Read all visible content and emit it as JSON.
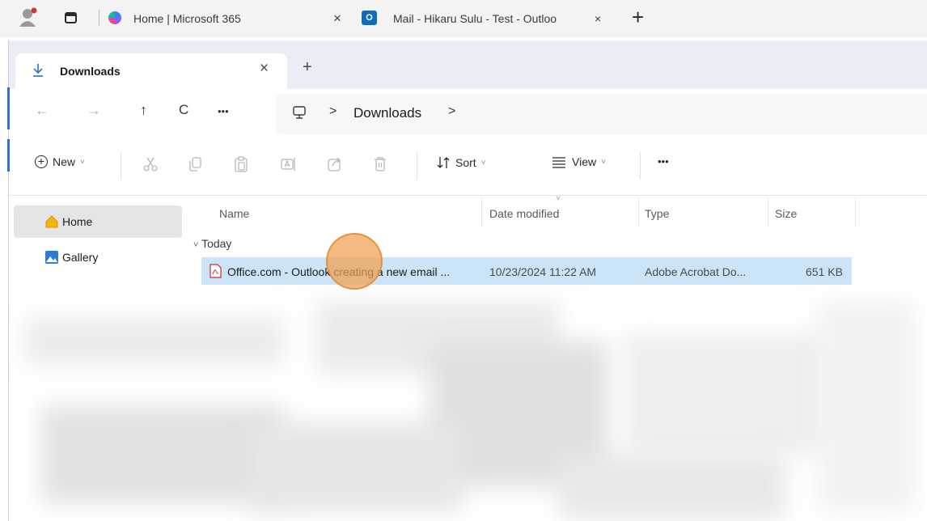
{
  "browser": {
    "tabs": [
      {
        "title": "Home | Microsoft 365",
        "close": "×"
      },
      {
        "title": "Mail - Hikaru Sulu - Test - Outloo",
        "close": "×"
      }
    ],
    "new_tab": "+"
  },
  "explorer": {
    "tab": {
      "title": "Downloads",
      "close": "×"
    },
    "new_tab": "+",
    "nav": {
      "back": "←",
      "forward": "→",
      "up": "↑",
      "refresh": "C",
      "more": "•••"
    },
    "breadcrumb": {
      "sep1": ">",
      "location": "Downloads",
      "sep2": ">"
    },
    "commands": {
      "new_label": "New",
      "new_chevron": "˅",
      "sort_label": "Sort",
      "sort_chevron": "˅",
      "view_label": "View",
      "view_chevron": "˅",
      "more": "•••"
    },
    "sidebar": {
      "items": [
        {
          "label": "Home",
          "selected": true
        },
        {
          "label": "Gallery",
          "selected": false
        }
      ]
    },
    "columns": [
      "Name",
      "Date modified",
      "Type",
      "Size"
    ],
    "group": {
      "label": "Today",
      "chevron": "˅"
    },
    "files": [
      {
        "name": "Office.com - Outlook creating a new email ...",
        "date_modified": "10/23/2024 11:22 AM",
        "type": "Adobe Acrobat Do...",
        "size": "651 KB"
      }
    ]
  },
  "colors": {
    "accent": "#0f6cbd",
    "selection": "#cce4f7",
    "click_indicator": "#f0a050"
  },
  "icons": [
    "avatar-icon",
    "tab-actions-icon",
    "microsoft365-icon",
    "outlook-icon",
    "download-icon",
    "computer-icon",
    "cut-icon",
    "copy-icon",
    "paste-icon",
    "rename-icon",
    "share-icon",
    "delete-icon",
    "sort-icon",
    "view-icon",
    "home-icon",
    "gallery-icon",
    "pdf-icon"
  ]
}
